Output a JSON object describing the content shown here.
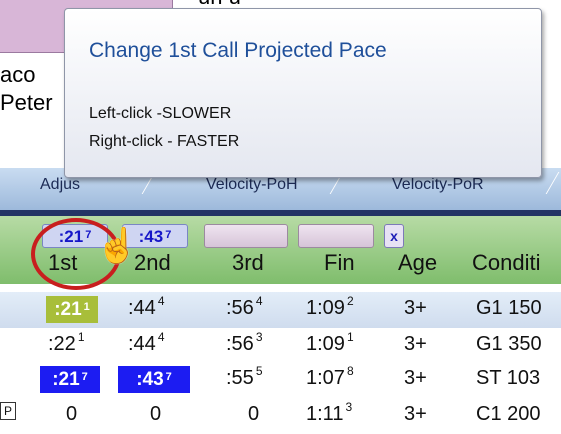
{
  "background": {
    "partial_text_top": "un u",
    "partial_left_1": "aco",
    "partial_left_2": "Peter"
  },
  "tooltip": {
    "title": "Change 1st Call Projected Pace",
    "line1": "Left-click -SLOWER",
    "line2": "Right-click - FASTER"
  },
  "tabs": [
    {
      "label": "Adjus"
    },
    {
      "label": "Velocity-PoH"
    },
    {
      "label": "Velocity-PoR"
    }
  ],
  "pace_selectors": {
    "first": {
      "value": ":21",
      "sup": "7"
    },
    "second": {
      "value": ":43",
      "sup": "7"
    },
    "clear": "x"
  },
  "columns": [
    "1st",
    "2nd",
    "3rd",
    "Fin",
    "Age",
    "Conditi"
  ],
  "rows": [
    {
      "c1": ":21",
      "c1s": "1",
      "c2": ":44",
      "c2s": "4",
      "c3": ":56",
      "c3s": "4",
      "fin": "1:09",
      "fins": "2",
      "age": "3+",
      "cond": "G1 150",
      "highlight": true
    },
    {
      "c1": ":22",
      "c1s": "1",
      "c2": ":44",
      "c2s": "4",
      "c3": ":56",
      "c3s": "3",
      "fin": "1:09",
      "fins": "1",
      "age": "3+",
      "cond": "G1 350"
    },
    {
      "c1": ":21",
      "c1s": "7",
      "c2": ":43",
      "c2s": "7",
      "c3": ":55",
      "c3s": "5",
      "fin": "1:07",
      "fins": "8",
      "age": "3+",
      "cond": "ST 103"
    },
    {
      "mark": "P",
      "c1": "0",
      "c2": "0",
      "c3": "0",
      "fin": "1:11",
      "fins": "3",
      "age": "3+",
      "cond": "C1 200"
    }
  ],
  "colors": {
    "tooltip_title": "#1f4f9a",
    "yellow_badge": "#a8be3a",
    "blue_badge": "#1c1cf2",
    "highlight_circle": "#c81e1e"
  },
  "icons": {
    "cursor": "hand-pointer-icon"
  }
}
